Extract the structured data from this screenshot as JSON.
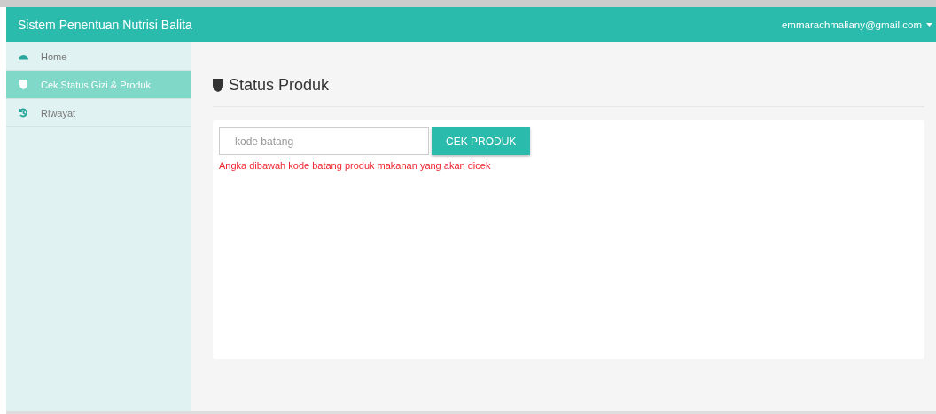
{
  "navbar": {
    "title": "Sistem Penentuan Nutrisi Balita",
    "user": "emmarachmaliany@gmail.com"
  },
  "sidebar": {
    "items": [
      {
        "label": "Home",
        "kind": "dashboard",
        "selected": false
      },
      {
        "label": "Cek Status Gizi & Produk",
        "kind": "shield",
        "selected": true
      },
      {
        "label": "Riwayat",
        "kind": "history",
        "selected": false
      }
    ]
  },
  "page": {
    "title": "Status Produk",
    "search": {
      "placeholder": "kode batang"
    },
    "button": "CEK PRODUK",
    "hint": "Angka dibawah kode batang produk makanan yang akan dicek"
  }
}
